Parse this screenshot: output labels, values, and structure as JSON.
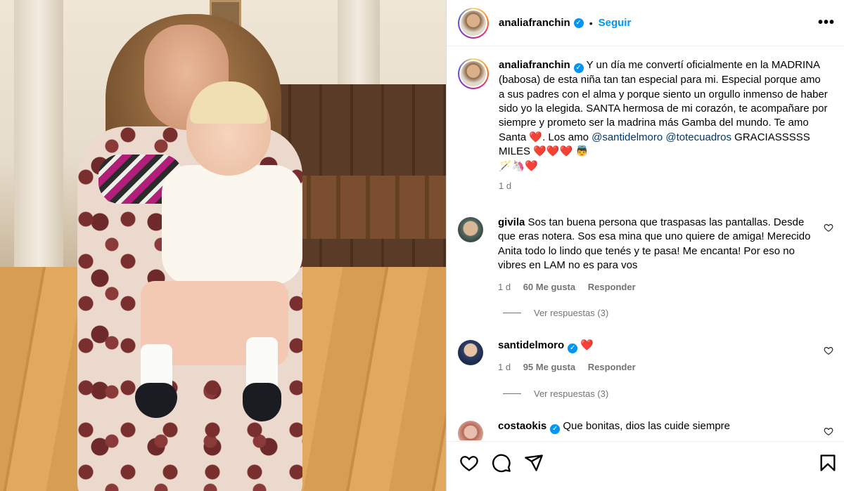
{
  "post": {
    "author": "analiafranchin",
    "follow_label": "Seguir",
    "more_label": "•••",
    "separator": "•"
  },
  "caption": {
    "username": "analiafranchin",
    "text_1": "Y un día me convertí oficialmente en la MADRINA (babosa) de esta niña tan tan especial para mi. Especial porque amo a sus padres con el alma y porque siento un orgullo inmenso de haber sido yo la elegida. SANTA hermosa de mi corazón, te acompañare por siempre y prometo ser la madrina más Gamba del mundo. Te amo Santa ",
    "heart": "❤️",
    "text_2": ". Los amo ",
    "mention_1": "@santidelmoro",
    "mention_2": "@totecuadros",
    "text_3": " GRACIASSSSS MILES ",
    "hearts": "❤️❤️❤️",
    "emoji_angel": "👼",
    "line_end": "🪄🦄❤️",
    "time": "1 d"
  },
  "comments": [
    {
      "username": "givila",
      "text": "Sos tan buena persona que traspasas las pantallas. Desde que eras notera. Sos esa mina que uno quiere de amiga! Merecido Anita todo lo lindo que tenés y te pasa! Me encanta! Por eso no vibres en LAM no es para vos",
      "time": "1 d",
      "likes": "60 Me gusta",
      "reply": "Responder",
      "view_replies": "Ver respuestas (3)"
    },
    {
      "username": "santidelmoro",
      "text": "❤️",
      "time": "1 d",
      "likes": "95 Me gusta",
      "reply": "Responder",
      "view_replies": "Ver respuestas (3)"
    },
    {
      "username": "costaokis",
      "text": "Que bonitas, dios las cuide siempre"
    }
  ],
  "colors": {
    "link_blue": "#0095f6",
    "mention_blue": "#00376b",
    "secondary_text": "#737373",
    "heart_red": "#e0102f"
  },
  "icons": [
    "heart-icon",
    "comment-icon",
    "share-icon",
    "save-icon",
    "verified-icon",
    "more-icon"
  ]
}
